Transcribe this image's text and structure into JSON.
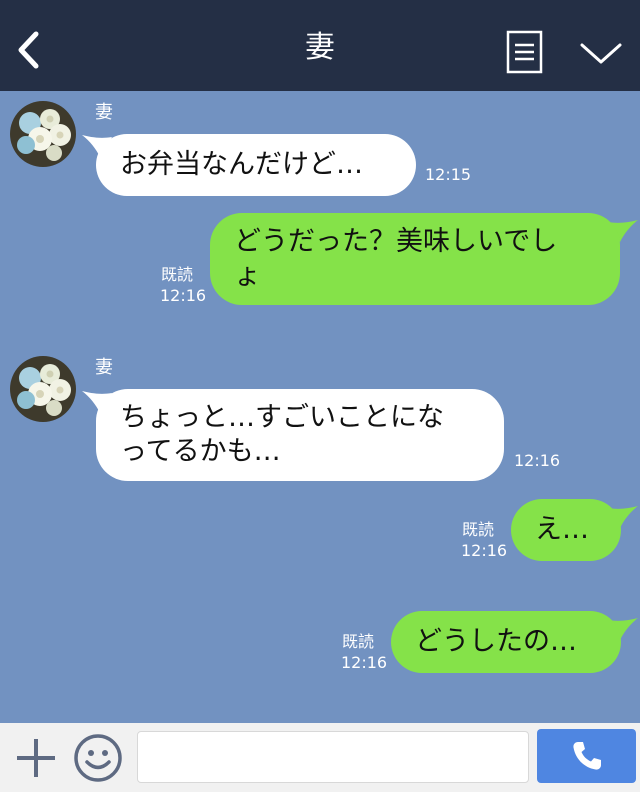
{
  "header": {
    "title": "妻"
  },
  "messages": [
    {
      "side": "in",
      "sender": "妻",
      "text": "お弁当なんだけど…",
      "time": "12:15"
    },
    {
      "side": "out",
      "text": "どうだった？美味しいでし\nょ",
      "read": "既読",
      "time": "12:16"
    },
    {
      "side": "in",
      "sender": "妻",
      "text": "ちょっと…すごいことにな\nってるかも…",
      "time": "12:16"
    },
    {
      "side": "out",
      "text": "え…",
      "read": "既読",
      "time": "12:16"
    },
    {
      "side": "out",
      "text": "どうしたの…",
      "read": "既読",
      "time": "12:16"
    }
  ],
  "icons": {
    "back": "back-arrow-icon",
    "menu": "menu-list-icon",
    "collapse": "chevron-down-icon",
    "add": "plus-icon",
    "emoji": "smiley-icon",
    "call": "phone-icon"
  },
  "colors": {
    "header_bg": "#242f45",
    "chat_bg": "#7292c1",
    "incoming_bubble": "#ffffff",
    "outgoing_bubble": "#85e249",
    "call_button": "#4f86e1"
  }
}
